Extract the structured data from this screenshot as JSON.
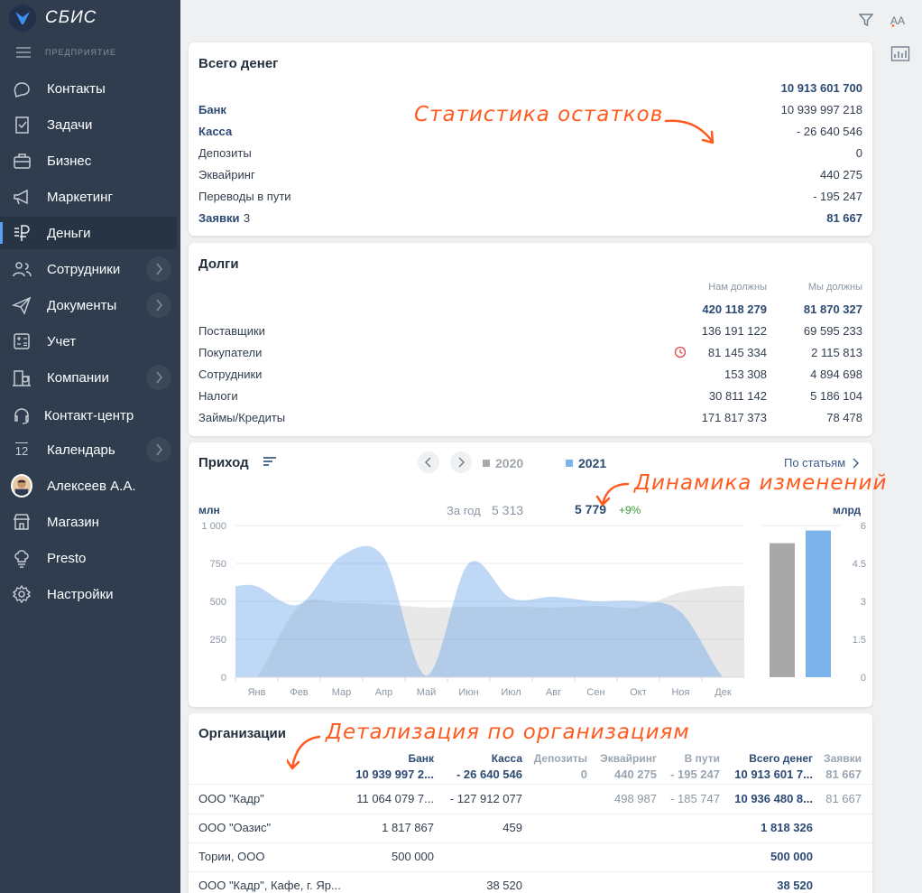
{
  "app": {
    "name": "СБИС",
    "menu_caption": "ПРЕДПРИЯТИЕ"
  },
  "nav": [
    {
      "label": "Контакты",
      "icon": "chat-icon"
    },
    {
      "label": "Задачи",
      "icon": "task-icon"
    },
    {
      "label": "Бизнес",
      "icon": "briefcase-icon"
    },
    {
      "label": "Маркетинг",
      "icon": "megaphone-icon"
    },
    {
      "label": "Деньги",
      "icon": "ruble-icon",
      "active": true
    },
    {
      "label": "Сотрудники",
      "icon": "people-icon",
      "arrow": true
    },
    {
      "label": "Документы",
      "icon": "paper-plane-icon",
      "arrow": true
    },
    {
      "label": "Учет",
      "icon": "calculator-icon"
    },
    {
      "label": "Компании",
      "icon": "building-icon",
      "arrow": true
    },
    {
      "label": "Контакт-центр",
      "icon": "headset-icon"
    },
    {
      "label": "Календарь",
      "icon": "calendar-icon",
      "badge": "12",
      "arrow": true
    },
    {
      "label": "Алексеев А.А.",
      "icon": "avatar"
    },
    {
      "label": "Магазин",
      "icon": "shop-icon"
    },
    {
      "label": "Presto",
      "icon": "chef-icon"
    },
    {
      "label": "Настройки",
      "icon": "gear-icon"
    }
  ],
  "money": {
    "title": "Всего денег",
    "total": "10 913 601 700",
    "rows": [
      {
        "label": "Банк",
        "value": "10 939 997 218",
        "bold": true
      },
      {
        "label": "Касса",
        "value": "- 26 640 546",
        "bold": true
      },
      {
        "label": "Депозиты",
        "value": "0"
      },
      {
        "label": "Эквайринг",
        "value": "440 275"
      },
      {
        "label": "Переводы в пути",
        "value": "- 195 247"
      }
    ],
    "requests": {
      "label": "Заявки",
      "count": "3",
      "value": "81 667"
    }
  },
  "debts": {
    "title": "Долги",
    "col_owed_to_us": "Нам должны",
    "col_we_owe": "Мы должны",
    "total_owed_to_us": "420 118 279",
    "total_we_owe": "81 870 327",
    "rows": [
      {
        "label": "Поставщики",
        "owed": "136 191 122",
        "owe": "69 595 233"
      },
      {
        "label": "Покупатели",
        "owed": "81 145 334",
        "owe": "2 115 813",
        "overdue": true
      },
      {
        "label": "Сотрудники",
        "owed": "153 308",
        "owe": "4 894 698"
      },
      {
        "label": "Налоги",
        "owed": "30 811 142",
        "owe": "5 186 104"
      },
      {
        "label": "Займы/Кредиты",
        "owed": "171 817 373",
        "owe": "78 478"
      }
    ]
  },
  "income": {
    "title": "Приход",
    "legend_2020": "2020",
    "legend_2021": "2021",
    "by_items": "По статьям",
    "unit_left": "млн",
    "unit_right": "млрд",
    "year_label": "За год",
    "year_2020": "5 313",
    "year_2021": "5 779",
    "delta": "+9%"
  },
  "chart_data": [
    {
      "type": "area",
      "categories": [
        "Янв",
        "Фев",
        "Мар",
        "Апр",
        "Май",
        "Июн",
        "Июл",
        "Авг",
        "Сен",
        "Окт",
        "Ноя",
        "Дек"
      ],
      "ylim": [
        0,
        1000
      ],
      "yticks": [
        "1 000",
        "750",
        "500",
        "250",
        "0"
      ],
      "ylabel": "млн",
      "series": [
        {
          "name": "2020",
          "values": [
            0,
            470,
            490,
            480,
            460,
            465,
            465,
            460,
            470,
            460,
            560,
            600
          ]
        },
        {
          "name": "2021",
          "values": [
            600,
            480,
            800,
            790,
            10,
            750,
            520,
            530,
            500,
            500,
            430,
            0
          ]
        }
      ]
    },
    {
      "type": "bar",
      "categories": [
        "2020",
        "2021"
      ],
      "values": [
        5.3,
        5.8
      ],
      "ylim": [
        0,
        6
      ],
      "yticks": [
        "6",
        "4.5",
        "3",
        "1.5",
        "0"
      ],
      "ylabel": "млрд"
    }
  ],
  "orgs": {
    "title": "Организации",
    "columns": [
      {
        "label": "Банк",
        "total": "10 939 997 2..."
      },
      {
        "label": "Касса",
        "total": "- 26 640 546"
      },
      {
        "label": "Депозиты",
        "total": "0"
      },
      {
        "label": "Эквайринг",
        "total": "440 275"
      },
      {
        "label": "В пути",
        "total": "- 195 247"
      },
      {
        "label": "Всего денег",
        "total": "10 913 601 7..."
      },
      {
        "label": "Заявки",
        "total": "81 667"
      }
    ],
    "rows": [
      {
        "name": "ООО \"Кадр\"",
        "cells": [
          "11 064 079 7...",
          "- 127 912 077",
          "",
          "498 987",
          "- 185 747",
          "10 936 480 8...",
          "81 667"
        ]
      },
      {
        "name": "ООО \"Оазис\"",
        "cells": [
          "1 817 867",
          "459",
          "",
          "",
          "",
          "1 818 326",
          ""
        ]
      },
      {
        "name": "Тории, ООО",
        "cells": [
          "500 000",
          "",
          "",
          "",
          "",
          "500 000",
          ""
        ]
      },
      {
        "name": "ООО \"Кадр\", Кафе, г. Яр...",
        "cells": [
          "",
          "38 520",
          "",
          "",
          "",
          "38 520",
          ""
        ]
      }
    ]
  },
  "annotations": {
    "stats": "Статистика остатков",
    "dynamics": "Динамика изменений",
    "details": "Детализация по организациям"
  },
  "colors": {
    "sidebar": "#2f3d4f",
    "accent": "#5b9df5",
    "annotation": "#ff5a1f",
    "bar_2020": "#a8a8a8",
    "bar_2021": "#7cb3ea"
  }
}
